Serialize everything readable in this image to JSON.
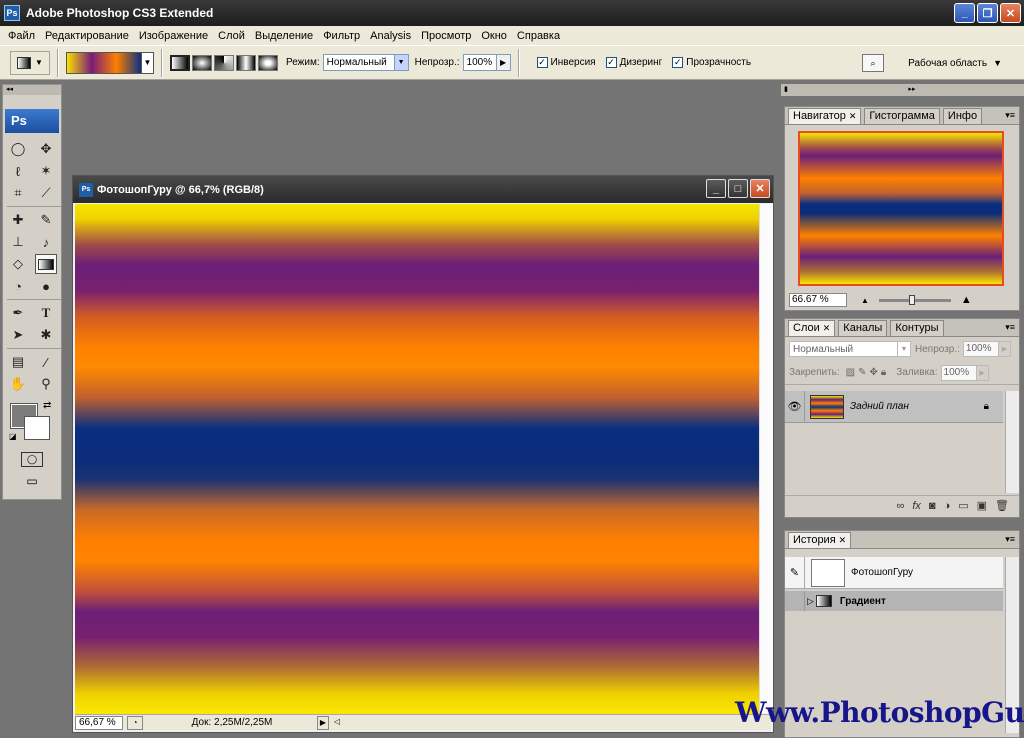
{
  "app": {
    "title": "Adobe Photoshop CS3 Extended",
    "logo_text": "Ps",
    "window_buttons": [
      "_",
      "❐",
      "✕"
    ]
  },
  "menu": [
    "Файл",
    "Редактирование",
    "Изображение",
    "Слой",
    "Выделение",
    "Фильтр",
    "Analysis",
    "Просмотр",
    "Окно",
    "Справка"
  ],
  "options": {
    "mode_label": "Режим:",
    "mode_value": "Нормальный",
    "opacity_label": "Непрозр.:",
    "opacity_value": "100%",
    "reverse_label": "Инверсия",
    "reverse_checked": true,
    "dither_label": "Дизеринг",
    "dither_checked": true,
    "transparency_label": "Прозрачность",
    "transparency_checked": true,
    "workspace_label": "Рабочая область"
  },
  "toolbox": {
    "logo_text": "Ps",
    "foreground_color": "#7b7b7b",
    "background_color": "#ffffff",
    "selected_tool": "gradient-tool"
  },
  "document": {
    "title": "ФотошопГуру @ 66,7% (RGB/8)",
    "zoom": "66,67 %",
    "doc_size": "Док: 2,25M/2,25M",
    "gradient_colors": [
      "#f4e800",
      "#6a1f78",
      "#ff8000",
      "#0a2f80"
    ]
  },
  "navigator": {
    "tabs": [
      "Навигатор",
      "Гистограмма",
      "Инфо"
    ],
    "zoom": "66.67 %",
    "view_box_color": "#ea4a20"
  },
  "layers": {
    "tabs": [
      "Слои",
      "Каналы",
      "Контуры"
    ],
    "blend_mode": "Нормальный",
    "opacity_label": "Непрозр.:",
    "opacity_value": "100%",
    "lock_label": "Закрепить:",
    "fill_label": "Заливка:",
    "fill_value": "100%",
    "items": [
      {
        "name": "Задний план",
        "visible": true,
        "locked": true
      }
    ]
  },
  "history": {
    "tabs": [
      "История"
    ],
    "snapshot_name": "ФотошопГуру",
    "steps": [
      "Градиент"
    ]
  },
  "watermark": "Www.PhotoshopGu.ru"
}
